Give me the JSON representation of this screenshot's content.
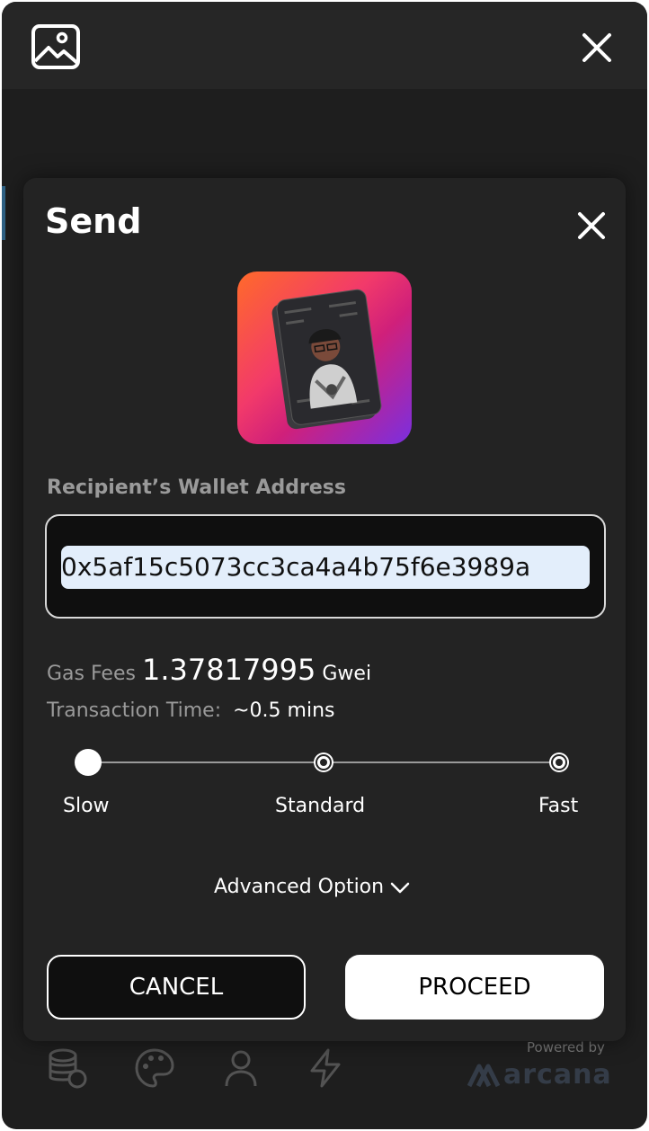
{
  "modal": {
    "title": "Send",
    "recipient_label": "Recipient’s Wallet Address",
    "recipient_value": "0x5af15c5073cc3ca4a4b75f6e3989a",
    "gas_label": "Gas Fees",
    "gas_value": "1.37817995",
    "gas_unit": "Gwei",
    "time_label": "Transaction Time:",
    "time_value": "~0.5 mins",
    "speed_options": [
      "Slow",
      "Standard",
      "Fast"
    ],
    "selected_speed": "Slow",
    "advanced_label": "Advanced Option",
    "cancel_label": "CANCEL",
    "proceed_label": "PROCEED"
  },
  "footer": {
    "powered_by": "Powered by",
    "brand": "arcana"
  },
  "icons": {
    "top_left": "image-icon",
    "top_right": "close-icon",
    "modal_close": "close-icon",
    "nav": [
      "coins-icon",
      "palette-icon",
      "user-icon",
      "lightning-icon"
    ],
    "advanced": "chevron-down-icon"
  },
  "colors": {
    "background": "#1e1e1e",
    "modal": "#232323",
    "input_highlight": "#e3eefb",
    "muted_text": "#9a9a9a"
  }
}
